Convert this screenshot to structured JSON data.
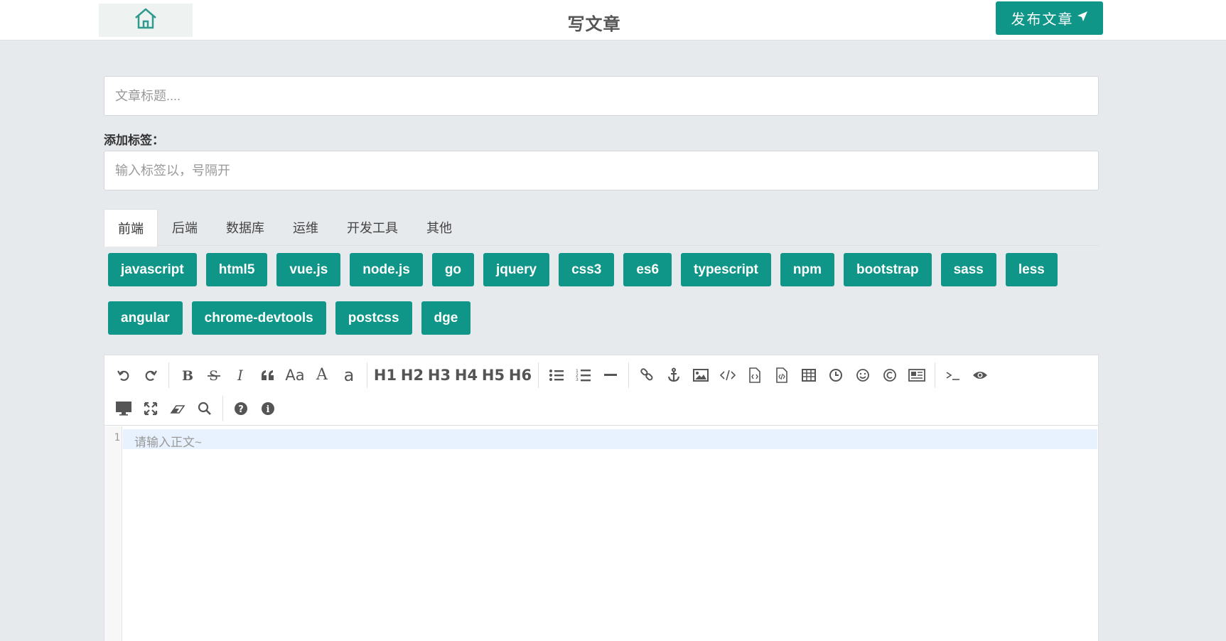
{
  "header": {
    "title": "写文章",
    "publish_label": "发布文章",
    "home_icon": "home-icon",
    "send_icon": "send-icon"
  },
  "form": {
    "title_placeholder": "文章标题....",
    "tag_label": "添加标签：",
    "tag_placeholder": "输入标签以，号隔开"
  },
  "tabs": [
    "前端",
    "后端",
    "数据库",
    "运维",
    "开发工具",
    "其他"
  ],
  "tags": {
    "row1": [
      "javascript",
      "html5",
      "vue.js",
      "node.js",
      "go",
      "jquery",
      "css3",
      "es6",
      "typescript",
      "npm",
      "bootstrap",
      "sass",
      "less"
    ],
    "row2": [
      "angular",
      "chrome-devtools",
      "postcss",
      "dge"
    ]
  },
  "toolbar": {
    "aa_label": "Aa",
    "a_upper_label": "A",
    "a_lower_label": "a",
    "h1": "H1",
    "h2": "H2",
    "h3": "H3",
    "h4": "H4",
    "h5": "H5",
    "h6": "H6"
  },
  "editor": {
    "line_number": "1",
    "placeholder": "请输入正文~"
  },
  "colors": {
    "accent": "#0f9688",
    "background": "#e7eaed"
  }
}
